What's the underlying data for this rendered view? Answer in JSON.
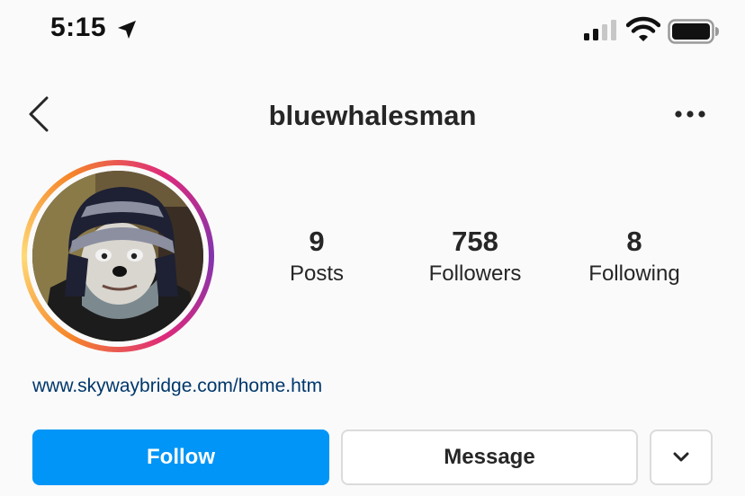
{
  "status_bar": {
    "time": "5:15",
    "icons": [
      "location-arrow-icon",
      "signal-icon",
      "wifi-icon",
      "battery-icon"
    ]
  },
  "header": {
    "username": "bluewhalesman",
    "back_icon": "chevron-left-icon",
    "menu_icon": "more-horizontal-icon"
  },
  "profile": {
    "avatar_icon": "profile-photo",
    "stats": {
      "posts": {
        "value": "9",
        "label": "Posts"
      },
      "followers": {
        "value": "758",
        "label": "Followers"
      },
      "following": {
        "value": "8",
        "label": "Following"
      }
    },
    "link": "www.skywaybridge.com/home.htm"
  },
  "actions": {
    "follow_label": "Follow",
    "message_label": "Message",
    "dropdown_icon": "chevron-down-icon"
  },
  "colors": {
    "background": "#fafafa",
    "follow_button": "#0095f6",
    "link": "#00376b",
    "text": "#262626",
    "border": "#dbdbdb"
  }
}
